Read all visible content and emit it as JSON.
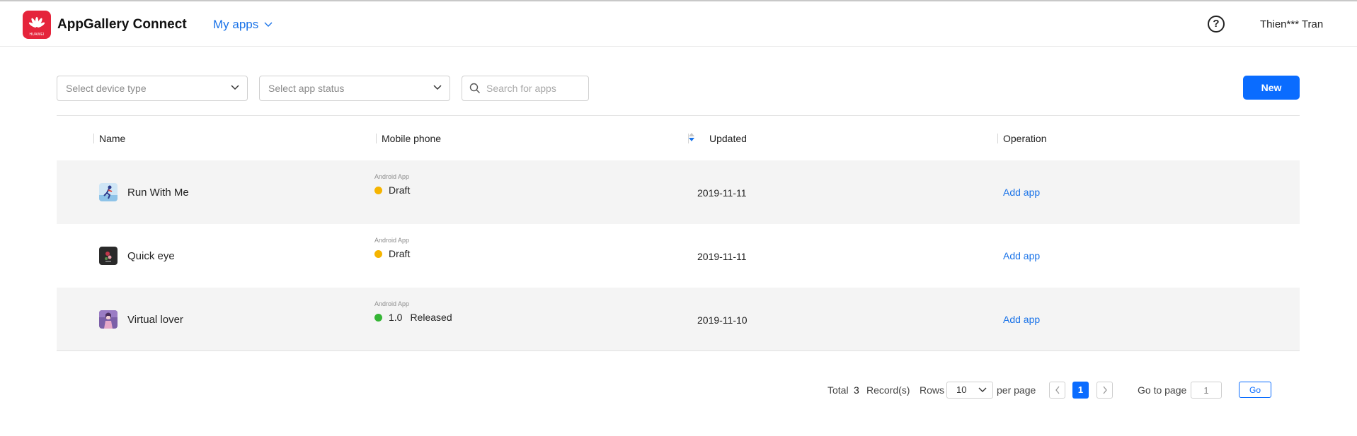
{
  "header": {
    "logo_brand": "HUAWEI",
    "app_title": "AppGallery Connect",
    "nav_menu": "My apps",
    "help_icon": "?",
    "user_name": "Thien*** Tran"
  },
  "filters": {
    "device_type_placeholder": "Select device type",
    "app_status_placeholder": "Select app status",
    "search_placeholder": "Search for apps",
    "new_button": "New"
  },
  "table": {
    "columns": {
      "name": "Name",
      "mobile_phone": "Mobile phone",
      "updated": "Updated",
      "operation": "Operation"
    },
    "rows": [
      {
        "name": "Run With Me",
        "type": "Android App",
        "version": "",
        "status": "Draft",
        "status_color": "#f5b400",
        "updated": "2019-11-11",
        "operation": "Add app",
        "icon": "runner-app-icon"
      },
      {
        "name": "Quick eye",
        "type": "Android App",
        "version": "",
        "status": "Draft",
        "status_color": "#f5b400",
        "updated": "2019-11-11",
        "operation": "Add app",
        "icon": "quick-eye-app-icon"
      },
      {
        "name": "Virtual lover",
        "type": "Android App",
        "version": "1.0",
        "status": "Released",
        "status_color": "#35b535",
        "updated": "2019-11-10",
        "operation": "Add app",
        "icon": "virtual-lover-app-icon"
      }
    ]
  },
  "pagination": {
    "total_label": "Total",
    "total_count": "3",
    "records_label": "Record(s)",
    "rows_label": "Rows",
    "rows_value": "10",
    "per_page_label": "per page",
    "prev_icon": "<",
    "current_page": "1",
    "next_icon": ">",
    "goto_label": "Go to page",
    "goto_value": "1",
    "go_button": "Go"
  },
  "colors": {
    "accent": "#0a6cff",
    "link": "#1a73e8",
    "brand": "#e5243b",
    "row_shade": "#f4f4f4"
  }
}
